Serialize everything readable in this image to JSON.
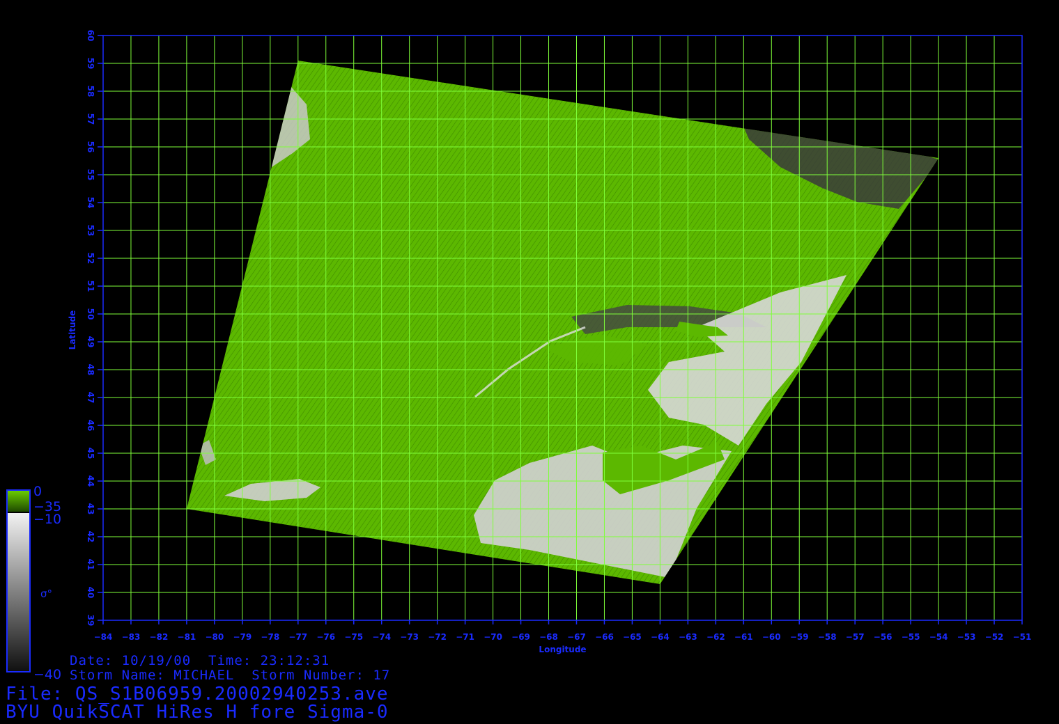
{
  "map": {
    "lon_range": [
      -84,
      -51
    ],
    "lat_range": [
      39,
      60
    ],
    "lon_ticks": [
      -84,
      -83,
      -82,
      -81,
      -80,
      -79,
      -78,
      -77,
      -76,
      -75,
      -74,
      -73,
      -72,
      -71,
      -70,
      -69,
      -68,
      -67,
      -66,
      -65,
      -64,
      -63,
      -62,
      -61,
      -60,
      -59,
      -58,
      -57,
      -56,
      -55,
      -54,
      -53,
      -52,
      -51
    ],
    "lat_ticks": [
      39,
      40,
      41,
      42,
      43,
      44,
      45,
      46,
      47,
      48,
      49,
      50,
      51,
      52,
      53,
      54,
      55,
      56,
      57,
      58,
      59,
      60
    ],
    "xlabel": "Longitude",
    "ylabel": "Latitude",
    "grid": true,
    "colors": {
      "grid": "#7fff3a",
      "axis": "#1a2bff",
      "ocean": "#5cb800",
      "land_light": "#e6e6e6",
      "land_dark": "#333333",
      "background": "#000000"
    },
    "swath_corners": [
      {
        "lon": -77,
        "lat": 59.1
      },
      {
        "lon": -54,
        "lat": 55.6
      },
      {
        "lon": -64,
        "lat": 40.3
      },
      {
        "lon": -81,
        "lat": 43.0
      }
    ]
  },
  "colorbar": {
    "green_range": [
      -35,
      0
    ],
    "gray_range": [
      -40,
      -10
    ],
    "labels": {
      "top": "0",
      "green_bottom": "−35",
      "gray_top": "−10",
      "bottom": "−40"
    },
    "symbol": "σ°"
  },
  "info": {
    "date_line": "Date: 10/19/00  Time: 23:12:31",
    "storm_line": "Storm Name: MICHAEL  Storm Number: 17",
    "file_line": "File: QS_S1B06959.20002940253.ave",
    "title_line": "BYU QuikSCAT HiRes H fore Sigma-0"
  }
}
